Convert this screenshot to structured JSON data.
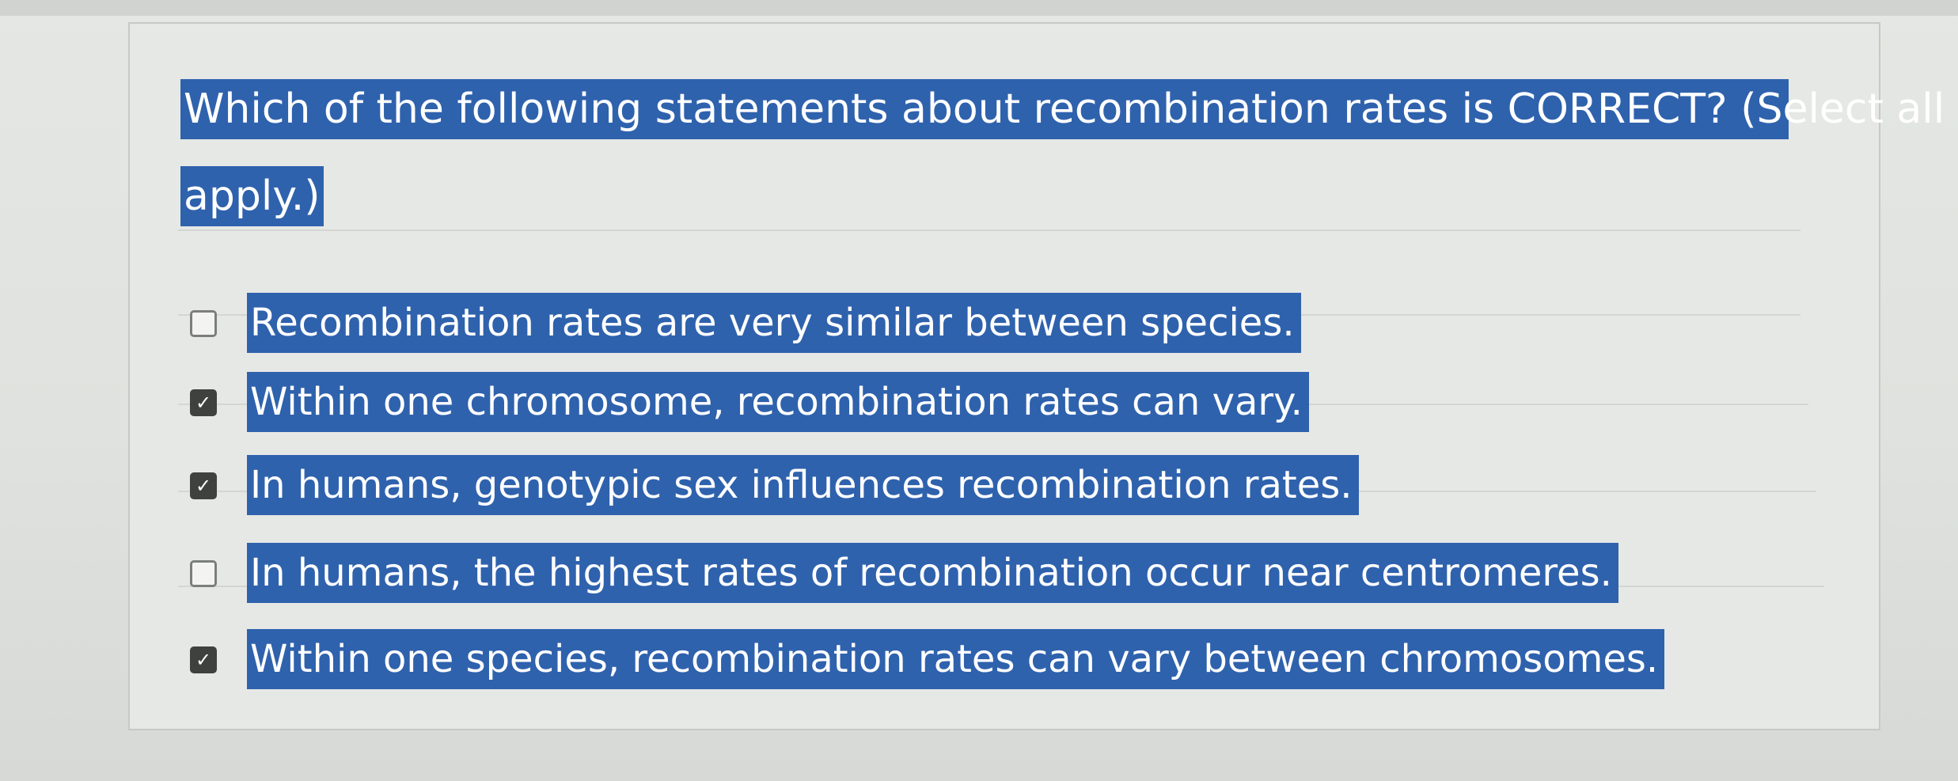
{
  "question": {
    "line1": "Which of the following statements about recombination rates is CORRECT? (Select all that",
    "line2": "apply.)"
  },
  "options": [
    {
      "label": "Recombination rates are very similar between species.",
      "checked": false
    },
    {
      "label": "Within one chromosome, recombination rates can vary.",
      "checked": true
    },
    {
      "label": "In humans, genotypic sex influences recombination rates.",
      "checked": true
    },
    {
      "label": "In humans, the highest rates of recombination occur near centromeres.",
      "checked": false
    },
    {
      "label": "Within one species, recombination rates can vary between chromosomes.",
      "checked": true
    }
  ],
  "icons": {
    "checked": "checkmark-icon"
  },
  "colors": {
    "highlight": "#2f62ad",
    "background": "#e6e8e5",
    "checkbox_checked": "#3f413e"
  }
}
